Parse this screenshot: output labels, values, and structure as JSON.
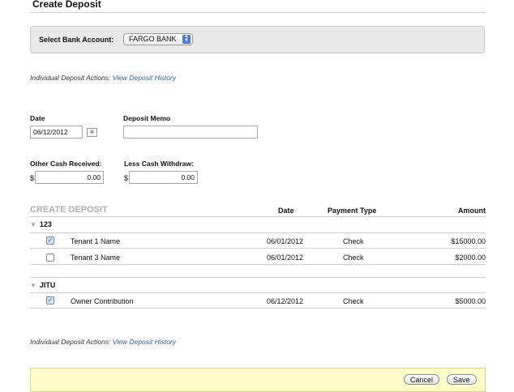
{
  "page": {
    "title": "Create Deposit"
  },
  "bank": {
    "label": "Select Bank Account:",
    "selected": "FARGO BANK"
  },
  "deposit_actions": {
    "prefix": "Individual Deposit Actions:",
    "link": "View Deposit History"
  },
  "form": {
    "date_label": "Date",
    "date_value": "06/12/2012",
    "memo_label": "Deposit Memo",
    "memo_value": "",
    "other_cash_label": "Other Cash Received:",
    "other_cash_currency": "$",
    "other_cash_value": "0.00",
    "less_cash_label": "Less Cash Withdraw:",
    "less_cash_currency": "$",
    "less_cash_value": "0.00"
  },
  "table": {
    "section_title": "CREATE DEPOSIT",
    "columns": {
      "date": "Date",
      "payment_type": "Payment Type",
      "amount": "Amount"
    },
    "groups": [
      {
        "name": "123",
        "rows": [
          {
            "checked": true,
            "name": "Tenant 1 Name",
            "date": "06/01/2012",
            "payment_type": "Check",
            "amount": "$15000.00"
          },
          {
            "checked": false,
            "name": "Tenant 3 Name",
            "date": "06/01/2012",
            "payment_type": "Check",
            "amount": "$2000.00"
          }
        ]
      },
      {
        "name": "JITU",
        "rows": [
          {
            "checked": true,
            "name": "Owner Contribution",
            "date": "06/12/2012",
            "payment_type": "Check",
            "amount": "$5000.00"
          }
        ]
      }
    ]
  },
  "footer": {
    "cancel_label": "Cancel",
    "save_label": "Save"
  }
}
